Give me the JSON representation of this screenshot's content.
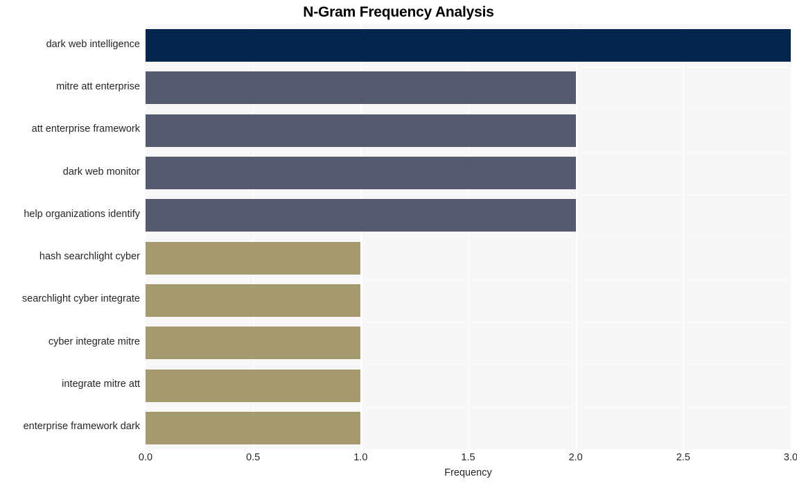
{
  "chart_data": {
    "type": "bar",
    "orientation": "horizontal",
    "title": "N-Gram Frequency Analysis",
    "xlabel": "Frequency",
    "ylabel": "",
    "categories": [
      "dark web intelligence",
      "mitre att enterprise",
      "att enterprise framework",
      "dark web monitor",
      "help organizations identify",
      "hash searchlight cyber",
      "searchlight cyber integrate",
      "cyber integrate mitre",
      "integrate mitre att",
      "enterprise framework dark"
    ],
    "values": [
      3,
      2,
      2,
      2,
      2,
      1,
      1,
      1,
      1,
      1
    ],
    "bar_colors": [
      "#04254e",
      "#565a6e",
      "#565a6e",
      "#565a6e",
      "#565a6e",
      "#a59a6f",
      "#a59a6f",
      "#a59a6f",
      "#a59a6f",
      "#a59a6f"
    ],
    "xlim": [
      0.0,
      3.0
    ],
    "xticks": [
      0.0,
      0.5,
      1.0,
      1.5,
      2.0,
      2.5,
      3.0
    ],
    "xticklabels": [
      "0.0",
      "0.5",
      "1.0",
      "1.5",
      "2.0",
      "2.5",
      "3.0"
    ],
    "grid": true,
    "grid_axis": "x",
    "grid_color": "#ffffff",
    "plot_background": "#f7f7f7",
    "figure_background": "#ffffff",
    "legend": null,
    "legend_position": "none"
  }
}
